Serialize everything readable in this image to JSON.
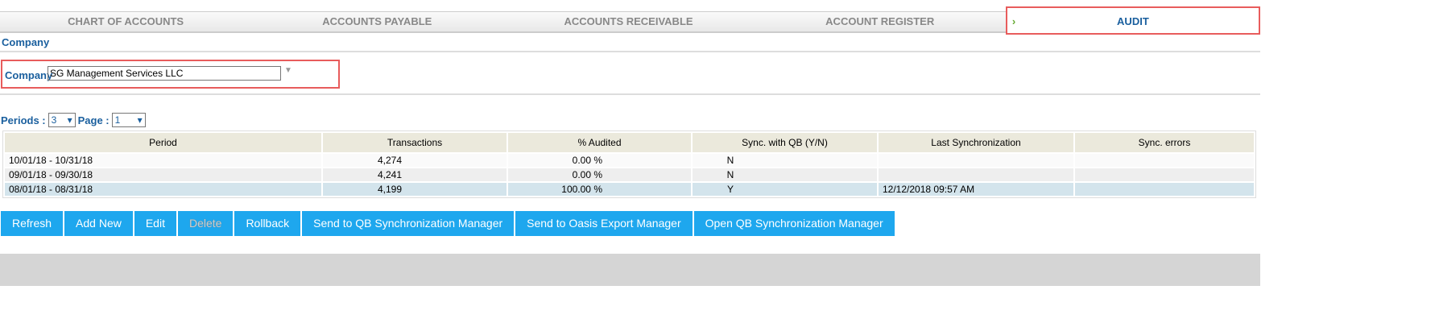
{
  "tabs": [
    "CHART OF ACCOUNTS",
    "ACCOUNTS PAYABLE",
    "ACCOUNTS RECEIVABLE",
    "ACCOUNT REGISTER",
    "AUDIT"
  ],
  "section_title": "Company",
  "company": {
    "label": "Company",
    "value": "SG Management Services LLC"
  },
  "periods": {
    "label": "Periods :",
    "value": "3"
  },
  "page": {
    "label": "Page :",
    "value": "1"
  },
  "table": {
    "headers": [
      "Period",
      "Transactions",
      "% Audited",
      "Sync. with QB (Y/N)",
      "Last Synchronization",
      "Sync. errors"
    ],
    "rows": [
      [
        "10/01/18 - 10/31/18",
        "4,274",
        "0.00 %",
        "N",
        "",
        ""
      ],
      [
        "09/01/18 - 09/30/18",
        "4,241",
        "0.00 %",
        "N",
        "",
        ""
      ],
      [
        "08/01/18 - 08/31/18",
        "4,199",
        "100.00 %",
        "Y",
        "12/12/2018 09:57 AM",
        ""
      ]
    ]
  },
  "buttons": [
    "Refresh",
    "Add New",
    "Edit",
    "Delete",
    "Rollback",
    "Send to QB Synchronization Manager",
    "Send to Oasis Export Manager",
    "Open QB Synchronization Manager"
  ]
}
